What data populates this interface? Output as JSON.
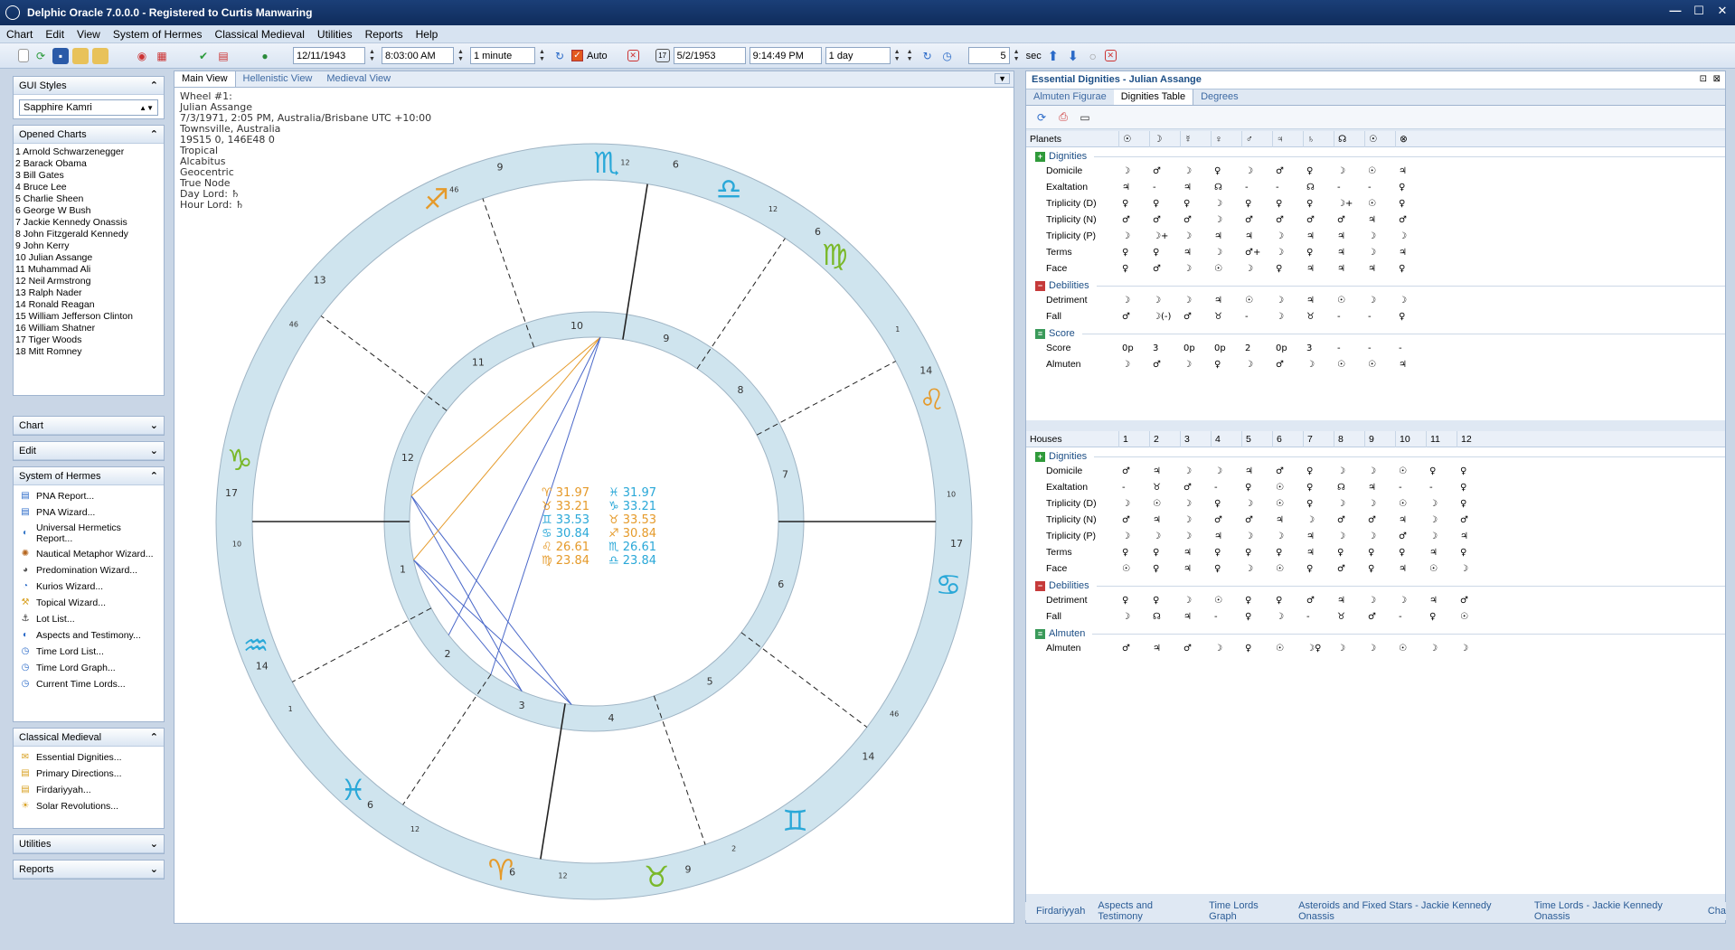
{
  "title": "Delphic Oracle 7.0.0.0 - Registered to Curtis Manwaring",
  "menu": [
    "Chart",
    "Edit",
    "View",
    "System of Hermes",
    "Classical Medieval",
    "Utilities",
    "Reports",
    "Help"
  ],
  "toolbar": {
    "date1": "12/11/1943",
    "time1": "8:03:00 AM",
    "step1": "1 minute",
    "auto_label": "Auto",
    "date2": "5/2/1953",
    "time2": "9:14:49 PM",
    "step2": "1 day",
    "interval": "5",
    "sec_label": "sec"
  },
  "left": {
    "gui_styles_title": "GUI Styles",
    "gui_style_value": "Sapphire Kamri",
    "opened_title": "Opened Charts",
    "opened_charts": [
      "1 Arnold Schwarzenegger",
      "2 Barack Obama",
      "3 Bill Gates",
      "4 Bruce Lee",
      "5 Charlie Sheen",
      "6 George W Bush",
      "7 Jackie Kennedy Onassis",
      "8 John Fitzgerald Kennedy",
      "9 John Kerry",
      "10 Julian Assange",
      "11 Muhammad Ali",
      "12 Neil Armstrong",
      "13 Ralph Nader",
      "14 Ronald Reagan",
      "15 William Jefferson Clinton",
      "16 William Shatner",
      "17 Tiger Woods",
      "18 Mitt Romney"
    ],
    "chart_section": "Chart",
    "edit_section": "Edit",
    "hermes_section": "System of Hermes",
    "hermes_items": [
      "PNA Report...",
      "PNA Wizard...",
      "Universal Hermetics Report...",
      "Nautical Metaphor Wizard...",
      "Predomination Wizard...",
      "Kurios Wizard...",
      "Topical Wizard...",
      "Lot List...",
      "Aspects and Testimony...",
      "Time Lord List...",
      "Time Lord Graph...",
      "Current Time Lords..."
    ],
    "medieval_section": "Classical Medieval",
    "medieval_items": [
      "Essential Dignities...",
      "Primary Directions...",
      "Firdariyyah...",
      "Solar Revolutions..."
    ],
    "utilities_section": "Utilities",
    "reports_section": "Reports"
  },
  "chart_tabs": [
    "Main View",
    "Hellenistic View",
    "Medieval View"
  ],
  "chart_info": [
    "Wheel #1:",
    "Julian Assange",
    "7/3/1971, 2:05 PM, Australia/Brisbane UTC +10:00",
    "Townsville, Australia",
    "19S15 0, 146E48 0",
    "Tropical",
    "Alcabitus",
    "Geocentric",
    "True Node",
    "Day Lord: ♄",
    "Hour Lord: ♄"
  ],
  "wheel": {
    "signs": [
      "♈",
      "♉",
      "♊",
      "♋",
      "♌",
      "♍",
      "♎",
      "♏",
      "♐",
      "♑",
      "♒",
      "♓"
    ],
    "house_numbers": [
      "1",
      "2",
      "3",
      "4",
      "5",
      "6",
      "7",
      "8",
      "9",
      "10",
      "11",
      "12"
    ],
    "center_stats": [
      [
        "♈ 31.97",
        "♓ 31.97"
      ],
      [
        "♉ 33.21",
        "♑ 33.21"
      ],
      [
        "♊ 33.53",
        "♉ 33.53"
      ],
      [
        "♋ 30.84",
        "♐ 30.84"
      ],
      [
        "♌ 26.61",
        "♏ 26.61"
      ],
      [
        "♍ 23.84",
        "♎ 23.84"
      ]
    ],
    "cusp_degrees": [
      "17",
      "14",
      "6",
      "6",
      "9",
      "14",
      "17",
      "14",
      "6",
      "6",
      "9",
      "13"
    ],
    "cusp_minutes": [
      "10",
      "1",
      "12",
      "12",
      "2",
      "46",
      "10",
      "1",
      "12",
      "12",
      "46",
      "46"
    ]
  },
  "dignities": {
    "title": "Essential Dignities - Julian Assange",
    "tabs": [
      "Almuten Figurae",
      "Dignities Table",
      "Degrees"
    ],
    "planets_label": "Planets",
    "planet_cols": [
      "☉",
      "☽",
      "☿",
      "♀",
      "♂",
      "♃",
      "♄",
      "☊",
      "☉",
      "⊗"
    ],
    "groups": [
      {
        "name": "Dignities",
        "kind": "plus",
        "rows": [
          {
            "label": "Domicile",
            "vals": [
              "☽",
              "♂",
              "☽",
              "♀",
              "☽",
              "♂",
              "♀",
              "☽",
              "☉",
              "♃"
            ]
          },
          {
            "label": "Exaltation",
            "vals": [
              "♃",
              "-",
              "♃",
              "☊",
              "-",
              "-",
              "☊",
              "-",
              "-",
              "♀"
            ]
          },
          {
            "label": "Triplicity (D)",
            "vals": [
              "♀",
              "♀",
              "♀",
              "☽",
              "♀",
              "♀",
              "♀",
              "☽+",
              "☉",
              "♀"
            ]
          },
          {
            "label": "Triplicity (N)",
            "vals": [
              "♂",
              "♂",
              "♂",
              "☽",
              "♂",
              "♂",
              "♂",
              "♂",
              "♃",
              "♂"
            ]
          },
          {
            "label": "Triplicity (P)",
            "vals": [
              "☽",
              "☽+",
              "☽",
              "♃",
              "♃",
              "☽",
              "♃",
              "♃",
              "☽",
              "☽"
            ]
          },
          {
            "label": "Terms",
            "vals": [
              "♀",
              "♀",
              "♃",
              "☽",
              "♂+",
              "☽",
              "♀",
              "♃",
              "☽",
              "♃"
            ]
          },
          {
            "label": "Face",
            "vals": [
              "♀",
              "♂",
              "☽",
              "☉",
              "☽",
              "♀",
              "♃",
              "♃",
              "♃",
              "♀"
            ]
          }
        ]
      },
      {
        "name": "Debilities",
        "kind": "minus",
        "rows": [
          {
            "label": "Detriment",
            "vals": [
              "☽",
              "☽",
              "☽",
              "♃",
              "☉",
              "☽",
              "♃",
              "☉",
              "☽",
              "☽"
            ]
          },
          {
            "label": "Fall",
            "vals": [
              "♂",
              "☽(-)",
              "♂",
              "♉",
              "-",
              "☽",
              "♉",
              "-",
              "-",
              "♀"
            ]
          }
        ]
      },
      {
        "name": "Score",
        "kind": "green",
        "rows": [
          {
            "label": "Score",
            "vals": [
              "0p",
              "3",
              "0p",
              "0p",
              "2",
              "0p",
              "3",
              "-",
              "-",
              "-"
            ]
          },
          {
            "label": "Almuten",
            "vals": [
              "☽",
              "♂",
              "☽",
              "♀",
              "☽",
              "♂",
              "☽",
              "☉",
              "☉",
              "♃"
            ]
          }
        ]
      }
    ],
    "houses_label": "Houses",
    "house_cols": [
      "1",
      "2",
      "3",
      "4",
      "5",
      "6",
      "7",
      "8",
      "9",
      "10",
      "11",
      "12"
    ],
    "house_groups": [
      {
        "name": "Dignities",
        "kind": "plus",
        "rows": [
          {
            "label": "Domicile",
            "vals": [
              "♂",
              "♃",
              "☽",
              "☽",
              "♃",
              "♂",
              "♀",
              "☽",
              "☽",
              "☉",
              "♀",
              "♀"
            ]
          },
          {
            "label": "Exaltation",
            "vals": [
              "-",
              "♉",
              "♂",
              "-",
              "♀",
              "☉",
              "♀",
              "☊",
              "♃",
              "-",
              "-",
              "♀"
            ]
          },
          {
            "label": "Triplicity (D)",
            "vals": [
              "☽",
              "☉",
              "☽",
              "♀",
              "☽",
              "☉",
              "♀",
              "☽",
              "☽",
              "☉",
              "☽",
              "♀"
            ]
          },
          {
            "label": "Triplicity (N)",
            "vals": [
              "♂",
              "♃",
              "☽",
              "♂",
              "♂",
              "♃",
              "☽",
              "♂",
              "♂",
              "♃",
              "☽",
              "♂"
            ]
          },
          {
            "label": "Triplicity (P)",
            "vals": [
              "☽",
              "☽",
              "☽",
              "♃",
              "☽",
              "☽",
              "♃",
              "☽",
              "☽",
              "♂",
              "☽",
              "♃"
            ]
          },
          {
            "label": "Terms",
            "vals": [
              "♀",
              "♀",
              "♃",
              "♀",
              "♀",
              "♀",
              "♃",
              "♀",
              "♀",
              "♀",
              "♃",
              "♀"
            ]
          },
          {
            "label": "Face",
            "vals": [
              "☉",
              "♀",
              "♃",
              "♀",
              "☽",
              "☉",
              "♀",
              "♂",
              "♀",
              "♃",
              "☉",
              "☽"
            ]
          }
        ]
      },
      {
        "name": "Debilities",
        "kind": "minus",
        "rows": [
          {
            "label": "Detriment",
            "vals": [
              "♀",
              "♀",
              "☽",
              "☉",
              "♀",
              "♀",
              "♂",
              "♃",
              "☽",
              "☽",
              "♃",
              "♂"
            ]
          },
          {
            "label": "Fall",
            "vals": [
              "☽",
              "☊",
              "♃",
              "-",
              "♀",
              "☽",
              "-",
              "♉",
              "♂",
              "-",
              "♀",
              "☉"
            ]
          }
        ]
      },
      {
        "name": "Almuten",
        "kind": "green",
        "rows": [
          {
            "label": "Almuten",
            "vals": [
              "♂",
              "♃",
              "♂",
              "☽",
              "♀",
              "☉",
              "☽♀",
              "☽",
              "☽",
              "☉",
              "☽",
              "☽"
            ]
          }
        ]
      }
    ]
  },
  "bottom_tabs": [
    "Firdariyyah",
    "Aspects and Testimony",
    "Time Lords Graph",
    "Asteroids and Fixed Stars - Jackie Kennedy Onassis",
    "Time Lords - Jackie Kennedy Onassis",
    "Cha"
  ],
  "colors": {
    "titlebar": "#1b3f78",
    "wheel_ring": "#cfe4ee",
    "aspect_blue": "#4a68c9",
    "aspect_orange": "#e59a2a"
  }
}
